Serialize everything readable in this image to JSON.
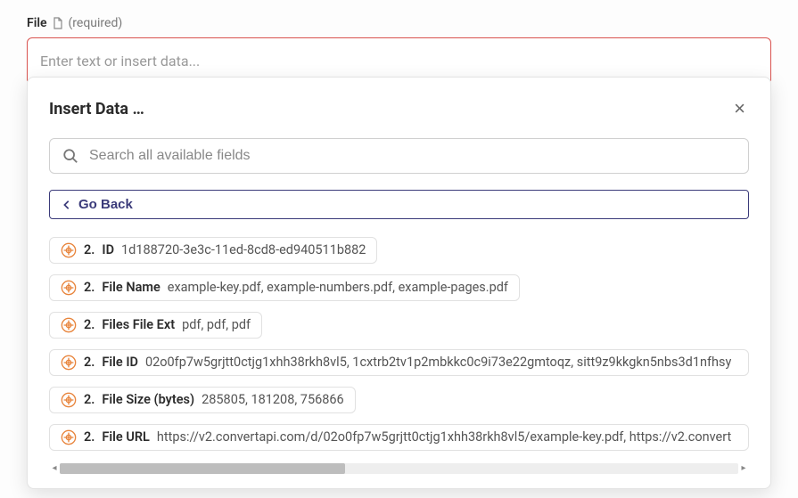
{
  "field": {
    "label": "File",
    "required_text": "(required)",
    "placeholder": "Enter text or insert data..."
  },
  "panel": {
    "title": "Insert Data …",
    "close": "×",
    "search_placeholder": "Search all available fields",
    "go_back": "Go Back",
    "items": [
      {
        "prefix": "2.",
        "label": "ID",
        "value": "1d188720-3e3c-11ed-8cd8-ed940511b882",
        "full": false
      },
      {
        "prefix": "2.",
        "label": "File Name",
        "value": "example-key.pdf, example-numbers.pdf, example-pages.pdf",
        "full": false
      },
      {
        "prefix": "2.",
        "label": "Files File Ext",
        "value": "pdf, pdf, pdf",
        "full": false
      },
      {
        "prefix": "2.",
        "label": "File ID",
        "value": "02o0fp7w5grjtt0ctjg1xhh38rkh8vl5, 1cxtrb2tv1p2mbkkc0c9i73e22gmtoqz, sitt9z9kkgkn5nbs3d1nfhsy",
        "full": true
      },
      {
        "prefix": "2.",
        "label": "File Size (bytes)",
        "value": "285805, 181208, 756866",
        "full": false
      },
      {
        "prefix": "2.",
        "label": "File URL",
        "value": "https://v2.convertapi.com/d/02o0fp7w5grjtt0ctjg1xhh38rkh8vl5/example-key.pdf, https://v2.convert",
        "full": true
      }
    ]
  }
}
